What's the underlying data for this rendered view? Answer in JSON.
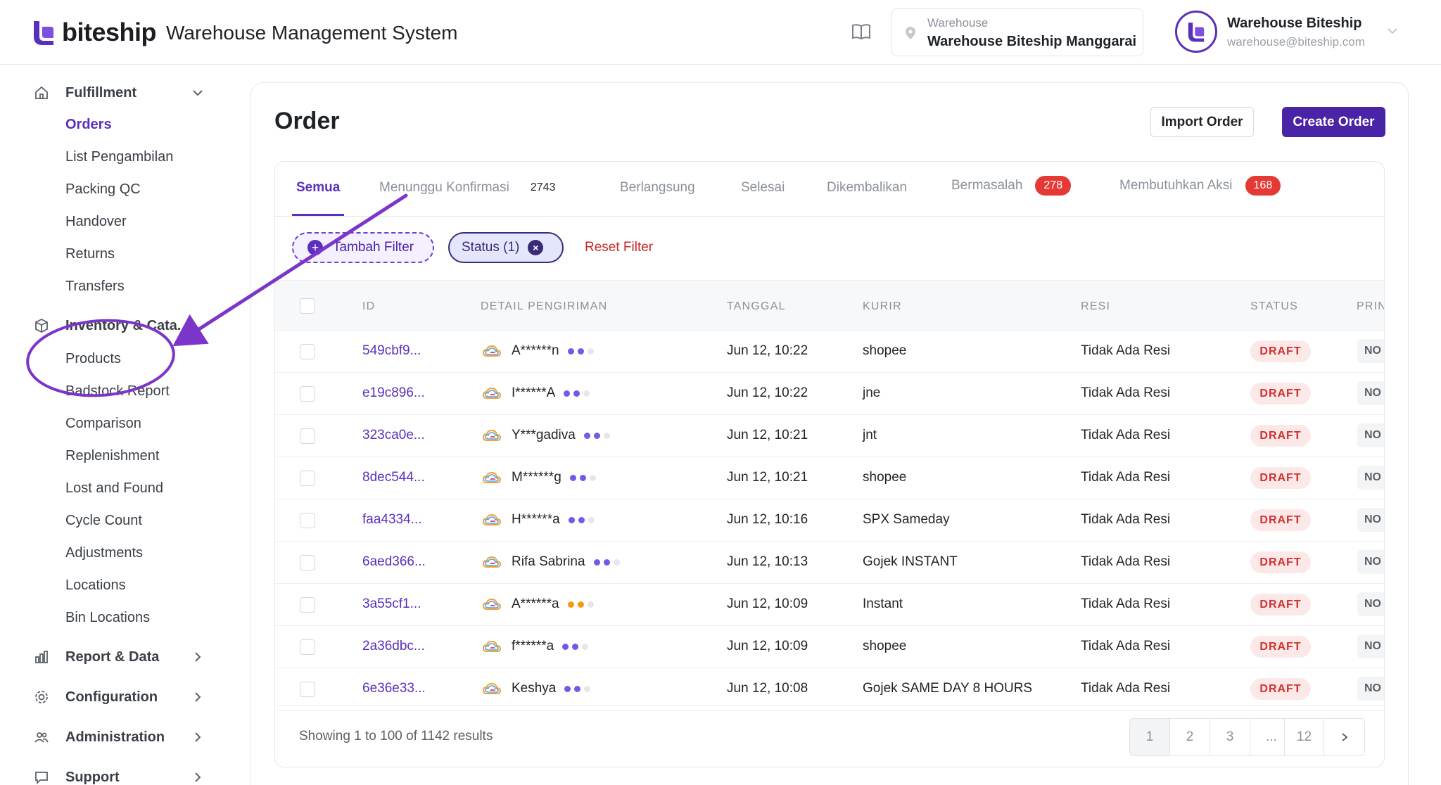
{
  "brand": {
    "logo_text": "biteship",
    "accent": "#5a2fbd"
  },
  "header": {
    "app_title": "Warehouse Management System",
    "warehouse_label": "Warehouse",
    "warehouse_value": "Warehouse Biteship Manggarai",
    "user_name": "Warehouse Biteship",
    "user_email": "warehouse@biteship.com"
  },
  "sidebar": {
    "fulfillment": {
      "label": "Fulfillment",
      "items": [
        "Orders",
        "List Pengambilan",
        "Packing QC",
        "Handover",
        "Returns",
        "Transfers"
      ]
    },
    "inventory": {
      "label": "Inventory & Cata...",
      "items": [
        "Products",
        "Badstock Report",
        "Comparison",
        "Replenishment",
        "Lost and Found",
        "Cycle Count",
        "Adjustments",
        "Locations",
        "Bin Locations"
      ]
    },
    "report": "Report & Data",
    "configuration": "Configuration",
    "administration": "Administration",
    "support": "Support"
  },
  "page": {
    "title": "Order",
    "import_label": "Import Order",
    "create_label": "Create Order"
  },
  "tabs": [
    {
      "label": "Semua"
    },
    {
      "label": "Menunggu Konfirmasi",
      "count": "2743"
    },
    {
      "label": "Berlangsung"
    },
    {
      "label": "Selesai"
    },
    {
      "label": "Dikembalikan"
    },
    {
      "label": "Bermasalah",
      "count": "278"
    },
    {
      "label": "Membutuhkan Aksi",
      "count": "168"
    }
  ],
  "filters": {
    "add_label": "Tambah Filter",
    "status_label": "Status (1)",
    "reset_label": "Reset Filter"
  },
  "table": {
    "columns": [
      "ID",
      "DETAIL PENGIRIMAN",
      "TANGGAL",
      "KURIR",
      "RESI",
      "STATUS",
      "PRIN"
    ],
    "rows": [
      {
        "id": "549cbf9...",
        "name": "A******n",
        "dots": [
          "#6c5ce7",
          "#6c5ce7",
          "#e6e7eb"
        ],
        "date": "Jun 12, 10:22",
        "kurir": "shopee",
        "resi": "Tidak Ada Resi",
        "status": "DRAFT",
        "print": "NO"
      },
      {
        "id": "e19c896...",
        "name": "I******A",
        "dots": [
          "#6c5ce7",
          "#6c5ce7",
          "#e6e7eb"
        ],
        "date": "Jun 12, 10:22",
        "kurir": "jne",
        "resi": "Tidak Ada Resi",
        "status": "DRAFT",
        "print": "NO"
      },
      {
        "id": "323ca0e...",
        "name": "Y***gadiva",
        "dots": [
          "#6c5ce7",
          "#6c5ce7",
          "#e6e7eb"
        ],
        "date": "Jun 12, 10:21",
        "kurir": "jnt",
        "resi": "Tidak Ada Resi",
        "status": "DRAFT",
        "print": "NO"
      },
      {
        "id": "8dec544...",
        "name": "M******g",
        "dots": [
          "#6c5ce7",
          "#6c5ce7",
          "#e6e7eb"
        ],
        "date": "Jun 12, 10:21",
        "kurir": "shopee",
        "resi": "Tidak Ada Resi",
        "status": "DRAFT",
        "print": "NO"
      },
      {
        "id": "faa4334...",
        "name": "H******a",
        "dots": [
          "#6c5ce7",
          "#6c5ce7",
          "#e6e7eb"
        ],
        "date": "Jun 12, 10:16",
        "kurir": "SPX Sameday",
        "resi": "Tidak Ada Resi",
        "status": "DRAFT",
        "print": "NO"
      },
      {
        "id": "6aed366...",
        "name": "Rifa Sabrina",
        "dots": [
          "#6c5ce7",
          "#6c5ce7",
          "#e6e7eb"
        ],
        "date": "Jun 12, 10:13",
        "kurir": "Gojek INSTANT",
        "resi": "Tidak Ada Resi",
        "status": "DRAFT",
        "print": "NO"
      },
      {
        "id": "3a55cf1...",
        "name": "A******a",
        "dots": [
          "#f39c12",
          "#f39c12",
          "#e6e7eb"
        ],
        "date": "Jun 12, 10:09",
        "kurir": "Instant",
        "resi": "Tidak Ada Resi",
        "status": "DRAFT",
        "print": "NO"
      },
      {
        "id": "2a36dbc...",
        "name": "f******a",
        "dots": [
          "#6c5ce7",
          "#6c5ce7",
          "#e6e7eb"
        ],
        "date": "Jun 12, 10:09",
        "kurir": "shopee",
        "resi": "Tidak Ada Resi",
        "status": "DRAFT",
        "print": "NO"
      },
      {
        "id": "6e36e33...",
        "name": "Keshya",
        "dots": [
          "#6c5ce7",
          "#6c5ce7",
          "#e6e7eb"
        ],
        "date": "Jun 12, 10:08",
        "kurir": "Gojek SAME DAY 8 HOURS",
        "resi": "Tidak Ada Resi",
        "status": "DRAFT",
        "print": "NO"
      }
    ]
  },
  "footer": {
    "showing": "Showing 1 to 100 of 1142 results",
    "pages": [
      "1",
      "2",
      "3",
      "...",
      "12"
    ],
    "next_icon": "chevron-right-icon"
  }
}
